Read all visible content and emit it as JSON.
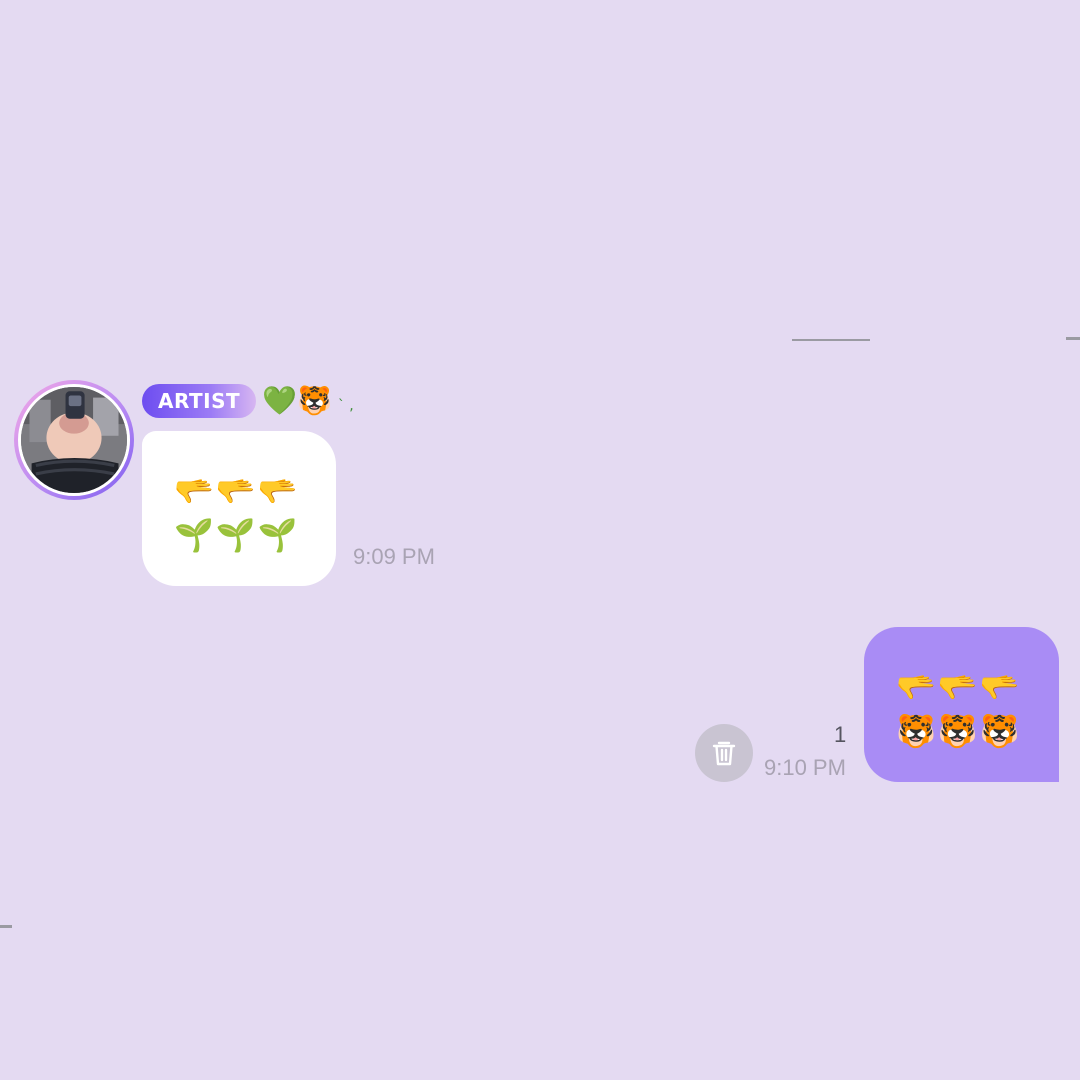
{
  "chat": {
    "incoming": {
      "badge": "ARTIST",
      "name_emojis": "💚🐯",
      "name_tail": "ˋ ,",
      "lines": [
        "🫳🫳🫳",
        "🌱🌱🌱"
      ],
      "time": "9:09 PM"
    },
    "outgoing": {
      "lines": [
        "🫳🫳🫳",
        "🐯🐯🐯"
      ],
      "time": "9:10 PM",
      "unread_count": "1"
    }
  },
  "colors": {
    "background": "#e4daf2",
    "incoming_bubble": "#ffffff",
    "outgoing_bubble": "#a98cf5",
    "badge_start": "#6d4df0",
    "timestamp": "#a9a3b3"
  },
  "icons": {
    "delete": "trash-icon",
    "avatar": "profile-photo"
  }
}
